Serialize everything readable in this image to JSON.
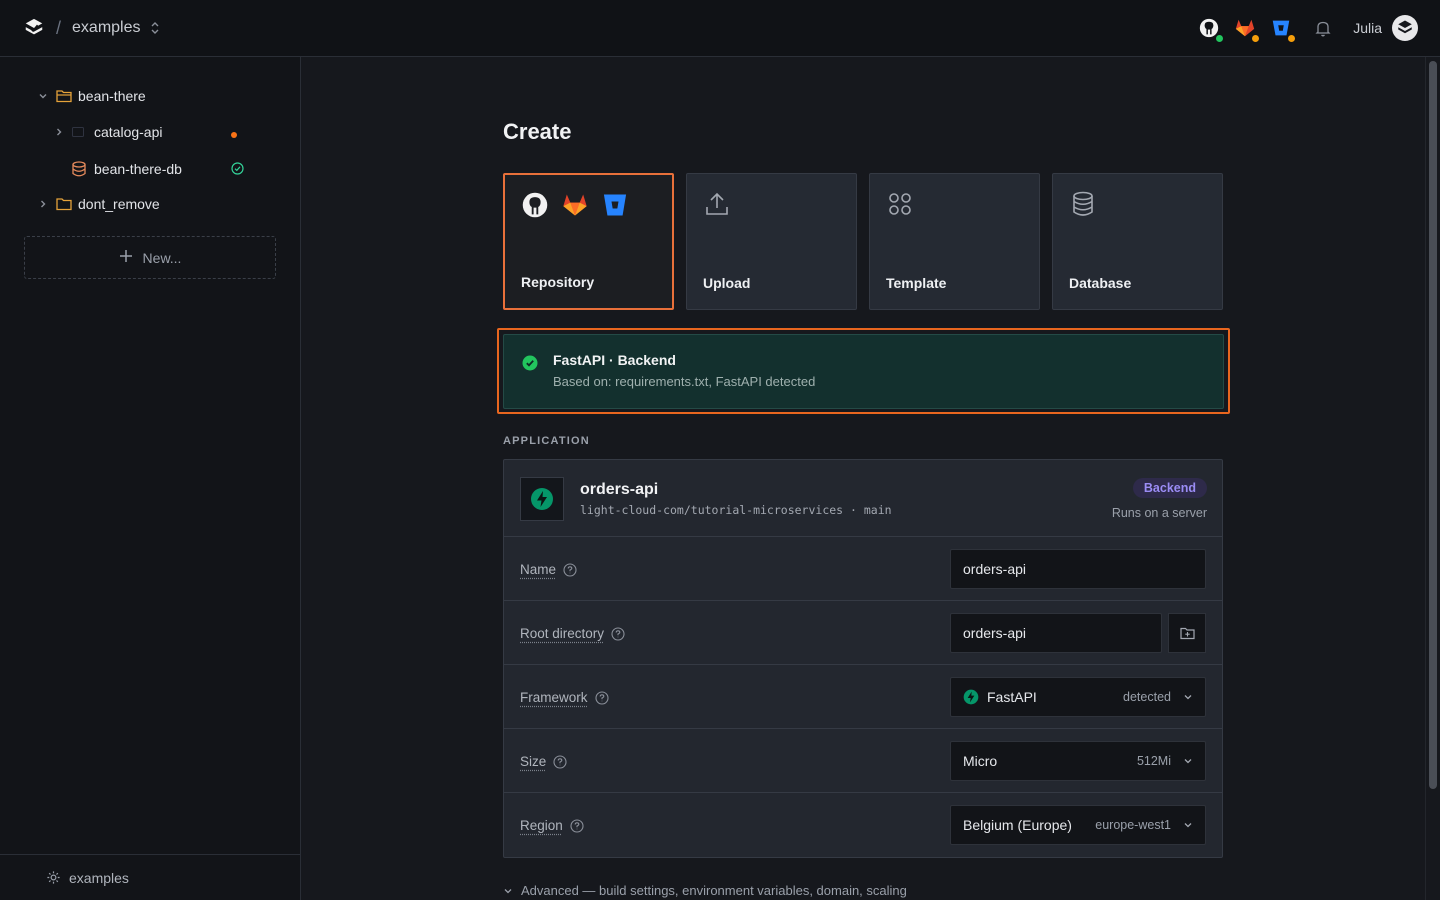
{
  "topbar": {
    "workspace": "examples",
    "username": "Julia",
    "providers": [
      {
        "name": "github",
        "status_color": "#22c55e"
      },
      {
        "name": "gitlab",
        "status_color": "#f59e0b"
      },
      {
        "name": "bitbucket",
        "status_color": "#f59e0b"
      }
    ]
  },
  "sidebar": {
    "tree": [
      {
        "label": "bean-there",
        "type": "folder",
        "expanded": true
      },
      {
        "label": "catalog-api",
        "type": "service",
        "status": "warning",
        "status_color": "#f97316"
      },
      {
        "label": "bean-there-db",
        "type": "database",
        "status": "ok",
        "status_color": "#34d399"
      },
      {
        "label": "dont_remove",
        "type": "folder",
        "expanded": false
      }
    ],
    "new_label": "New...",
    "footer_label": "examples"
  },
  "create": {
    "title": "Create",
    "sources": [
      {
        "label": "Repository",
        "selected": true
      },
      {
        "label": "Upload",
        "selected": false
      },
      {
        "label": "Template",
        "selected": false
      },
      {
        "label": "Database",
        "selected": false
      }
    ]
  },
  "detection": {
    "title": "FastAPI · Backend",
    "subtitle": "Based on: requirements.txt, FastAPI detected"
  },
  "application": {
    "section_label": "APPLICATION",
    "name": "orders-api",
    "repo": "light-cloud-com/tutorial-microservices · main",
    "badge": "Backend",
    "runs_on": "Runs on a server",
    "fields": {
      "name": {
        "label": "Name",
        "value": "orders-api"
      },
      "root": {
        "label": "Root directory",
        "value": "orders-api"
      },
      "framework": {
        "label": "Framework",
        "value": "FastAPI",
        "hint": "detected"
      },
      "size": {
        "label": "Size",
        "value": "Micro",
        "hint": "512Mi"
      },
      "region": {
        "label": "Region",
        "value": "Belgium (Europe)",
        "hint": "europe-west1"
      }
    }
  },
  "advanced_label": "Advanced — build settings, environment variables, domain, scaling",
  "colors": {
    "accent": "#e8703a",
    "highlight_outline": "#e8661f",
    "success": "#22c55e",
    "fastapi": "#059669",
    "backend_badge": "#9b8cf5"
  }
}
